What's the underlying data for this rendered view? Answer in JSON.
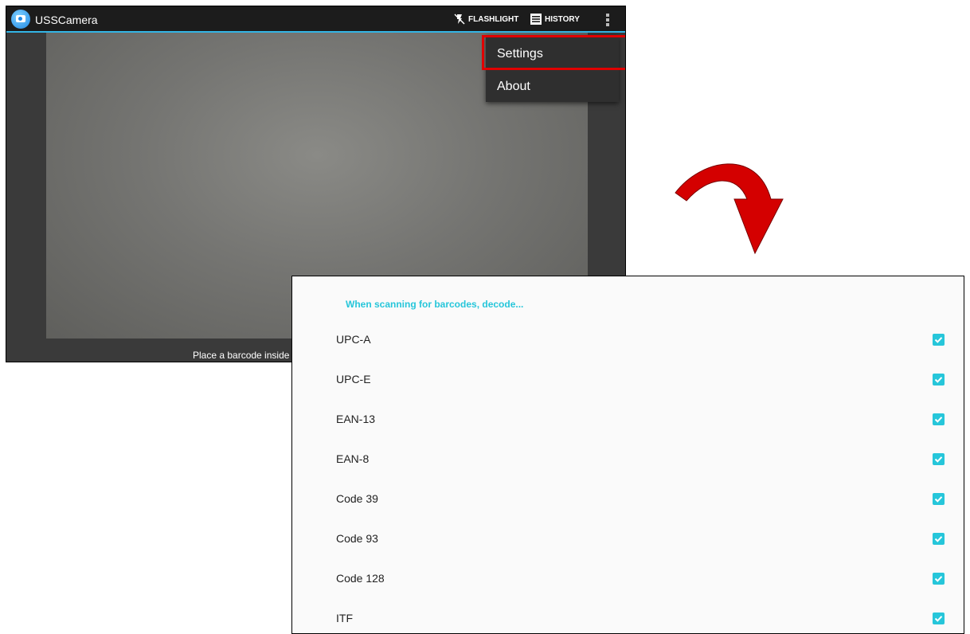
{
  "camera": {
    "app_title": "USSCamera",
    "flashlight_label": "FLASHLIGHT",
    "history_label": "HISTORY",
    "hint": "Place a barcode inside",
    "menu": [
      {
        "label": "Settings",
        "highlighted": true
      },
      {
        "label": "About",
        "highlighted": false
      }
    ]
  },
  "settings": {
    "section_header": "When scanning for barcodes, decode...",
    "items": [
      {
        "label": "UPC-A",
        "checked": true
      },
      {
        "label": "UPC-E",
        "checked": true
      },
      {
        "label": "EAN-13",
        "checked": true
      },
      {
        "label": "EAN-8",
        "checked": true
      },
      {
        "label": "Code 39",
        "checked": true
      },
      {
        "label": "Code 93",
        "checked": true
      },
      {
        "label": "Code 128",
        "checked": true
      },
      {
        "label": "ITF",
        "checked": true
      }
    ]
  },
  "colors": {
    "accent": "#26c6da",
    "highlight": "#e00000",
    "actionbar_line": "#33b5e5"
  },
  "icons": [
    "app-camera-icon",
    "flashlight-off-icon",
    "history-icon",
    "overflow-menu-icon",
    "checkbox-checked-icon",
    "curved-arrow-icon"
  ]
}
